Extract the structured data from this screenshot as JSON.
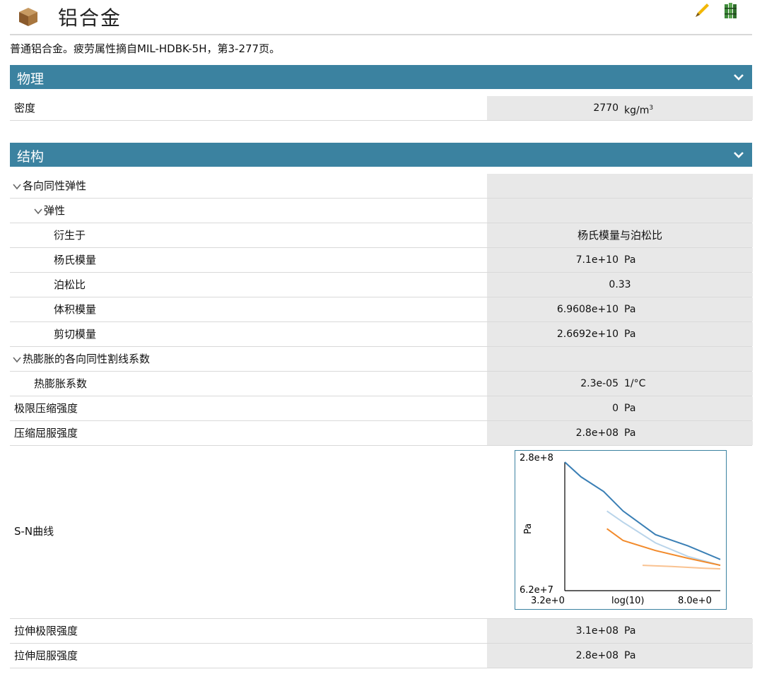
{
  "header": {
    "title": "铝合金",
    "description": "普通铝合金。疲劳属性摘自MIL-HDBK-5H，第3-277页。",
    "icons": [
      "material-cube-icon",
      "edit-pencil-icon",
      "library-books-icon"
    ]
  },
  "sections": {
    "physics": {
      "label": "物理",
      "chevron": "chevron-down-icon"
    },
    "structure": {
      "label": "结构",
      "chevron": "chevron-down-icon"
    }
  },
  "density": {
    "label": "密度",
    "value": "2770",
    "unit": "kg/m",
    "unit_sup": "3"
  },
  "structure_rows": {
    "isotropic": {
      "label": "各向同性弹性"
    },
    "elasticity": {
      "label": "弹性"
    },
    "derived_from": {
      "label": "衍生于",
      "value": "杨氏模量与泊松比"
    },
    "youngs": {
      "label": "杨氏模量",
      "value": "7.1e+10",
      "unit": "Pa"
    },
    "poisson": {
      "label": "泊松比",
      "value": "0.33"
    },
    "bulk": {
      "label": "体积模量",
      "value": "6.9608e+10",
      "unit": "Pa"
    },
    "shear": {
      "label": "剪切模量",
      "value": "2.6692e+10",
      "unit": "Pa"
    },
    "thermal_group": {
      "label": "热膨胀的各向同性割线系数"
    },
    "thermal_coef": {
      "label": "热膨胀系数",
      "value": "2.3e-05",
      "unit": "1/°C"
    },
    "ult_compress": {
      "label": "极限压缩强度",
      "value": "0",
      "unit": "Pa"
    },
    "compress_yield": {
      "label": "压缩屈服强度",
      "value": "2.8e+08",
      "unit": "Pa"
    },
    "sn_curve": {
      "label": "S-N曲线"
    },
    "tensile_ult": {
      "label": "拉伸极限强度",
      "value": "3.1e+08",
      "unit": "Pa"
    },
    "tensile_yield": {
      "label": "拉伸屈服强度",
      "value": "2.8e+08",
      "unit": "Pa"
    }
  },
  "colors": {
    "header_bg": "#3b82a0",
    "value_bg": "#e8e8e8",
    "series": [
      "#3a7fb5",
      "#b9d4ea",
      "#f28a2b",
      "#f9c291"
    ]
  },
  "chart_data": {
    "type": "line",
    "ylabel": "Pa",
    "xlabel": "log(10)",
    "y_tick_labels": [
      "2.8e+8",
      "6.2e+7"
    ],
    "x_tick_labels": [
      "3.2e+0",
      "8.0e+0"
    ],
    "xlim": [
      3.2,
      8.0
    ],
    "ylim": [
      62000000.0,
      280000000.0
    ],
    "series": [
      {
        "color": "#3a7fb5",
        "x": [
          3.2,
          3.7,
          4.4,
          5.0,
          6.0,
          7.0,
          8.0
        ],
        "y": [
          280000000.0,
          255000000.0,
          230000000.0,
          197000000.0,
          157000000.0,
          138000000.0,
          115000000.0
        ]
      },
      {
        "color": "#b9d4ea",
        "x": [
          4.5,
          5.0,
          6.0,
          7.0,
          8.0
        ],
        "y": [
          197000000.0,
          178000000.0,
          143000000.0,
          120000000.0,
          105000000.0
        ]
      },
      {
        "color": "#f28a2b",
        "x": [
          4.5,
          5.0,
          6.0,
          7.0,
          8.0
        ],
        "y": [
          167000000.0,
          147000000.0,
          130000000.0,
          117000000.0,
          105000000.0
        ]
      },
      {
        "color": "#f9c291",
        "x": [
          5.6,
          6.5,
          7.5,
          8.0
        ],
        "y": [
          105000000.0,
          103000000.0,
          100000000.0,
          99000000.0
        ]
      }
    ]
  }
}
